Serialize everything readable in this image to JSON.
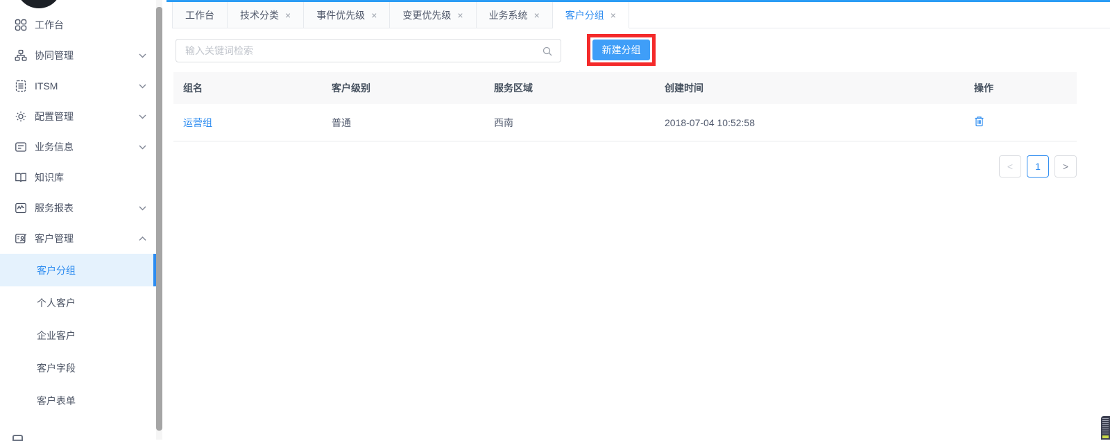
{
  "app": {
    "accent_color": "#2d8cf0",
    "annotation_color": "#f42a2a",
    "link_color": "#2d8cf0"
  },
  "sidebar": {
    "items": [
      {
        "label": "工作台",
        "icon": "grid-icon",
        "chevron": "none"
      },
      {
        "label": "协同管理",
        "icon": "org-icon",
        "chevron": "down"
      },
      {
        "label": "ITSM",
        "icon": "doc-icon",
        "chevron": "down"
      },
      {
        "label": "配置管理",
        "icon": "gear-icon",
        "chevron": "down"
      },
      {
        "label": "业务信息",
        "icon": "note-icon",
        "chevron": "down"
      },
      {
        "label": "知识库",
        "icon": "book-icon",
        "chevron": "none"
      },
      {
        "label": "服务报表",
        "icon": "chart-icon",
        "chevron": "down"
      },
      {
        "label": "客户管理",
        "icon": "contact-icon",
        "chevron": "up"
      }
    ],
    "submenu": [
      {
        "label": "客户分组",
        "active": true
      },
      {
        "label": "个人客户",
        "active": false
      },
      {
        "label": "企业客户",
        "active": false
      },
      {
        "label": "客户字段",
        "active": false
      },
      {
        "label": "客户表单",
        "active": false
      }
    ]
  },
  "tabs": [
    {
      "label": "工作台",
      "closable": false,
      "active": false
    },
    {
      "label": "技术分类",
      "closable": true,
      "active": false
    },
    {
      "label": "事件优先级",
      "closable": true,
      "active": false
    },
    {
      "label": "变更优先级",
      "closable": true,
      "active": false
    },
    {
      "label": "业务系统",
      "closable": true,
      "active": false
    },
    {
      "label": "客户分组",
      "closable": true,
      "active": true
    }
  ],
  "close_glyph": "×",
  "toolbar": {
    "search_placeholder": "输入关键词检索",
    "new_group_button": "新建分组"
  },
  "table": {
    "columns": [
      "组名",
      "客户级别",
      "服务区域",
      "创建时间",
      "操作"
    ],
    "rows": [
      {
        "group_name": "运营组",
        "customer_level": "普通",
        "service_region": "西南",
        "created_at": "2018-07-04 10:52:58",
        "action": "delete"
      }
    ]
  },
  "pagination": {
    "prev": "<",
    "page": "1",
    "next": ">"
  }
}
